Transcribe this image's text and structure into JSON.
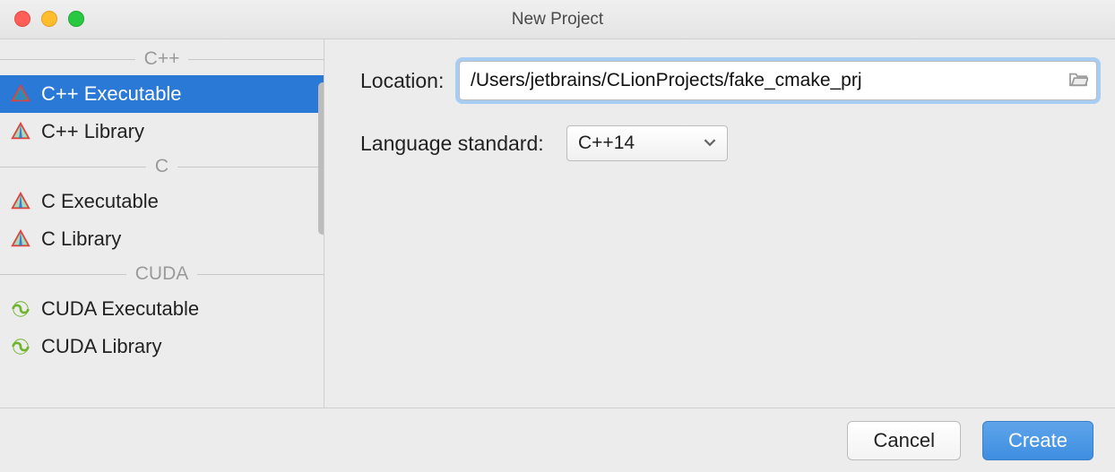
{
  "window": {
    "title": "New Project"
  },
  "sidebar": {
    "sections": [
      {
        "label": "C++",
        "items": [
          {
            "label": "C++ Executable",
            "icon": "clion",
            "selected": true
          },
          {
            "label": "C++ Library",
            "icon": "clion",
            "selected": false
          }
        ]
      },
      {
        "label": "C",
        "items": [
          {
            "label": "C Executable",
            "icon": "clion",
            "selected": false
          },
          {
            "label": "C Library",
            "icon": "clion",
            "selected": false
          }
        ]
      },
      {
        "label": "CUDA",
        "items": [
          {
            "label": "CUDA Executable",
            "icon": "cuda",
            "selected": false
          },
          {
            "label": "CUDA Library",
            "icon": "cuda",
            "selected": false
          }
        ]
      }
    ]
  },
  "form": {
    "location_label": "Location:",
    "location_value": "/Users/jetbrains/CLionProjects/fake_cmake_prj",
    "language_standard_label": "Language standard:",
    "language_standard_value": "C++14"
  },
  "footer": {
    "cancel_label": "Cancel",
    "create_label": "Create"
  }
}
